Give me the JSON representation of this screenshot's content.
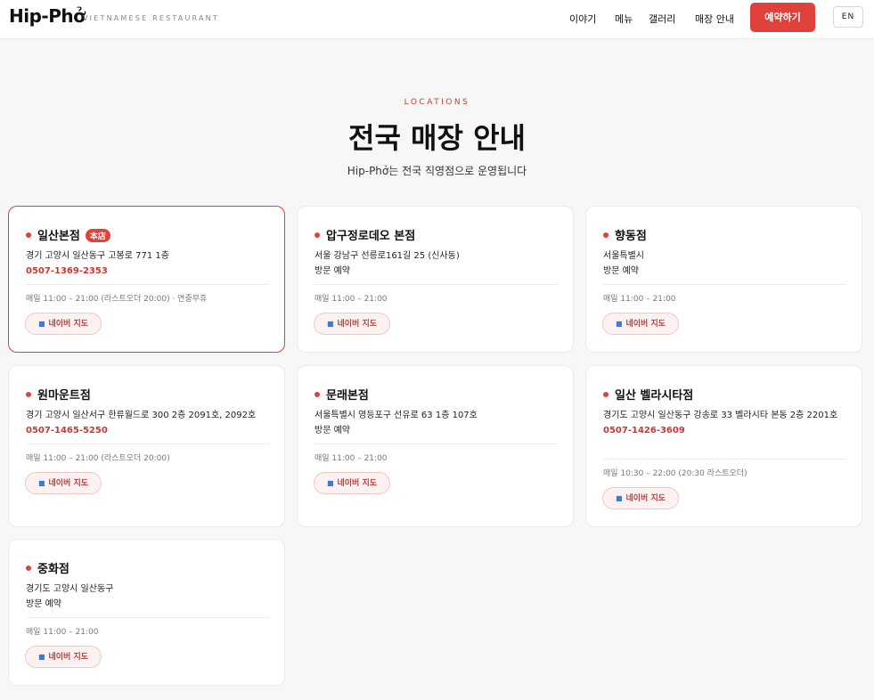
{
  "header": {
    "logo": "Hip-Phở",
    "logo_sub": "VIETNAMESE RESTAURANT",
    "nav": [
      "이야기",
      "메뉴",
      "갤러리",
      "매장 안내"
    ],
    "reserve_label": "예약하기",
    "lang_label": "EN"
  },
  "hero": {
    "eyebrow": "LOCATIONS",
    "title": "전국 매장 안내",
    "subtitle": "Hip-Phở는 전국 직영점으로 운영됩니다"
  },
  "map_button_label": "네이버 지도",
  "map_icon": "map-icon",
  "accent_color": "#e0413b",
  "stores": [
    {
      "name": "일산본점",
      "badge": "本店",
      "address": "경기 고양시 일산동구 고봉로 771 1층",
      "phone": "0507-1369-2353",
      "hours": "매일 11:00 – 21:00 (라스트오더 20:00) · 연중무휴"
    },
    {
      "name": "압구정로데오 본점",
      "address": "서울 강남구 선릉로161길 25 (신사동)",
      "phone": "방문 예약",
      "hours": "매일 11:00 – 21:00"
    },
    {
      "name": "향동점",
      "address": "서울특별시",
      "phone": "방문 예약",
      "hours": "매일 11:00 – 21:00"
    },
    {
      "name": "원마운트점",
      "address": "경기 고양시 일산서구 한류월드로 300 2층 2091호, 2092호",
      "phone": "0507-1465-5250",
      "hours": "매일 11:00 – 21:00 (라스트오더 20:00)"
    },
    {
      "name": "문래본점",
      "address": "서울특별시 영등포구 선유로 63 1층 107호",
      "phone": "방문 예약",
      "hours": "매일 11:00 – 21:00"
    },
    {
      "name": "일산 벨라시타점",
      "address": "경기도 고양시 일산동구 강송로 33 벨라시타 본동 2층 2201호",
      "phone": "0507-1426-3609",
      "hours": "매일 10:30 – 22:00 (20:30 라스트오더)"
    },
    {
      "name": "중화점",
      "address": "경기도 고양시 일산동구",
      "phone": "방문 예약",
      "hours": "매일 11:00 – 21:00"
    }
  ]
}
